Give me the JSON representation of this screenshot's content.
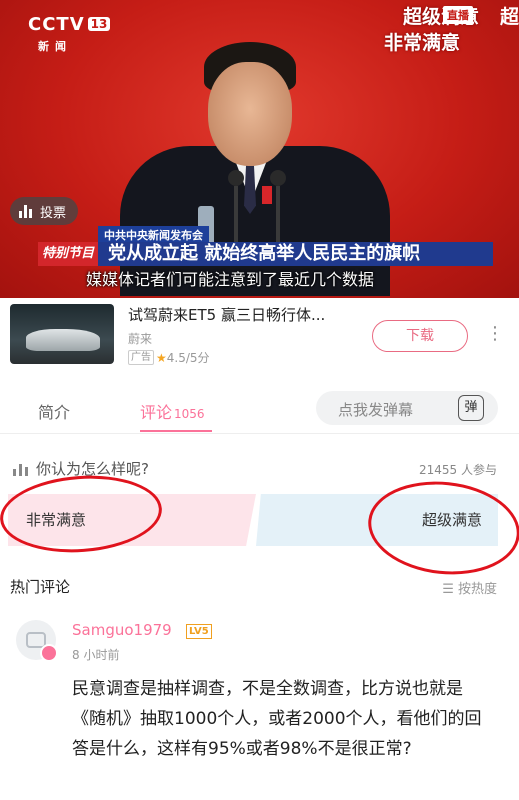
{
  "video": {
    "channel_logo": "CCTV",
    "channel_number": "13",
    "channel_sub": "新闻",
    "overlay_top": "超级满意",
    "overlay_live": "直播",
    "overlay_edge": "超",
    "overlay_second": "非常满意",
    "vote_button": "投票",
    "banner_label": "中共中央新闻发布会",
    "banner_tag": "特别节目",
    "banner_main": "党从成立起 就始终高举人民民主的旗帜",
    "subtitle": "媒媒体记者们可能注意到了最近几个数据"
  },
  "ad": {
    "title": "试驾蔚来ET5 赢三日畅行体...",
    "advertiser": "蔚来",
    "ad_badge": "广告",
    "rating": "4.5/5分",
    "download_label": "下载"
  },
  "tabs": {
    "intro": "简介",
    "comments": "评论",
    "comments_count": "1056",
    "danmaku_placeholder": "点我发弹幕",
    "danmaku_icon": "弹"
  },
  "poll": {
    "question": "你认为怎么样呢?",
    "participants": "21455 人参与",
    "option_left": "非常满意",
    "option_right": "超级满意"
  },
  "comments": {
    "section_title": "热门评论",
    "sort_label": "按热度",
    "items": [
      {
        "user": "Samguo1979",
        "level": "LV5",
        "time": "8 小时前",
        "text": "民意调查是抽样调查，不是全数调查，比方说也就是《随机》抽取1000个人，或者2000个人，看他们的回答是什么，这样有95%或者98%不是很正常?"
      }
    ]
  },
  "colors": {
    "accent": "#fb7299",
    "annotation_red": "#e0131d",
    "cctv_red": "#c51d16"
  }
}
